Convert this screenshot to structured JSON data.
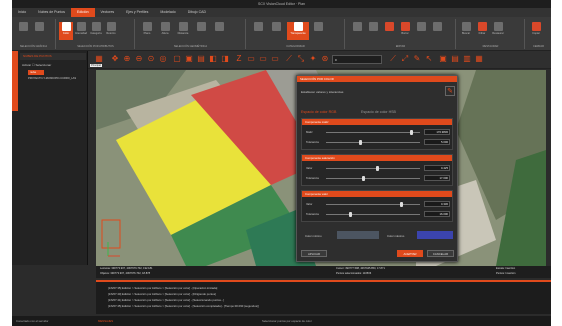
{
  "window_title": "SCX VisionCloud Editor · Plan",
  "menu": [
    "Inicio",
    "Nubes de Puntos",
    "Edición",
    "Vectores",
    "Ejes y Perfiles",
    "Modelado",
    "Dibujo CAD"
  ],
  "menu_active_index": 2,
  "ribbon": {
    "groups": [
      {
        "label": "SELECCIÓN GRÁFICA"
      },
      {
        "label": "SELECCIÓN POR ATRIBUTOS"
      },
      {
        "label": "SELECCIÓN GEOMÉTRICA"
      },
      {
        "label": "CATEGORIZAR"
      },
      {
        "label": "EDITAR"
      },
      {
        "label": "RESTAURAR"
      },
      {
        "label": "CERRAR"
      }
    ],
    "buttons": [
      "Color",
      "Intensidad",
      "Categoría",
      "Retorno",
      "Plano",
      "Altura",
      "Distancia",
      "Borrar",
      "Transparente",
      "Buscar",
      "Filtrar",
      "Restaurar",
      "Copiar"
    ]
  },
  "left_panel": {
    "header": "NUBES DE PUNTOS",
    "checkbox": "Activar ☐ Seleccionar",
    "item": "nube",
    "item_sub": "PROYECTO-Y-MUNICIPIO-CURRO_LAS"
  },
  "toolbar": {
    "tag": "Principal",
    "dropdown_value": "0"
  },
  "dialog": {
    "title": "SELECCIÓN POR COLOR",
    "subtitle": "Establecer valores y tolerancias",
    "tab_active": "Espacio de color RGB",
    "tab_inactive": "Espacio de color HSB",
    "sections": [
      {
        "title": "Componente matiz",
        "rows": [
          {
            "label": "Matiz",
            "value": "0.91",
            "display": "170.9830"
          },
          {
            "label": "Tolerancia",
            "value": "0.37",
            "display": "5.000"
          }
        ]
      },
      {
        "title": "Componente saturación",
        "rows": [
          {
            "label": "Valor",
            "value": "0.55",
            "display": "0.425"
          },
          {
            "label": "Tolerancia",
            "value": "0.40",
            "display": "17.000"
          }
        ]
      },
      {
        "title": "Componente valor",
        "rows": [
          {
            "label": "Valor",
            "value": "0.80",
            "display": "0.330"
          },
          {
            "label": "Tolerancia",
            "value": "0.26",
            "display": "16.000"
          }
        ]
      }
    ],
    "color_min_label": "Color mínimo",
    "color_max_label": "Color máximo",
    "color_min": "#4c5561",
    "color_max": "#3b44ad",
    "apply": "APLICAR",
    "accept": "ACEPTAR",
    "cancel": "CANCELAR"
  },
  "status": {
    "left1": "Lecturas: 390773.907, 4067976.702, 192.181",
    "left2": "Objetos: 390773.907, 4067976.702, 18.878",
    "mid1": "Cursor: 390777.598, 4067945.850, 17.871",
    "mid2": "Puntos seleccionados: 110506",
    "right1": "Escala: Insertion",
    "right2": "Puntos: Insertion"
  },
  "console": {
    "lines": [
      "[1/6/07:35] Edición > Selección por Atributo > [Selección por color] - [Operación iniciada]",
      "[1/6/07:40] Edición > Selección por Atributo > [Selección por color] - [Dirigiendo puntos]",
      "[1/6/07:41] Edición > Selección por Atributo > [Selección por color] - [Seleccionando puntos...]",
      "[1/6/07:45] Edición > Selección por Atributo > [Selección por color] - [Selección completada] - [Tiempo:00.090 (segundos)]"
    ]
  },
  "bottom": {
    "left": "Conectado con el servidor",
    "tab": "MENSAJES",
    "right": "Seleccionar puntos por espacio de color"
  },
  "colors": {
    "accent": "#e04a1c",
    "field_yellow": "#e9e23a",
    "court_red": "#d04a45",
    "grass": "#3f8a4f"
  }
}
